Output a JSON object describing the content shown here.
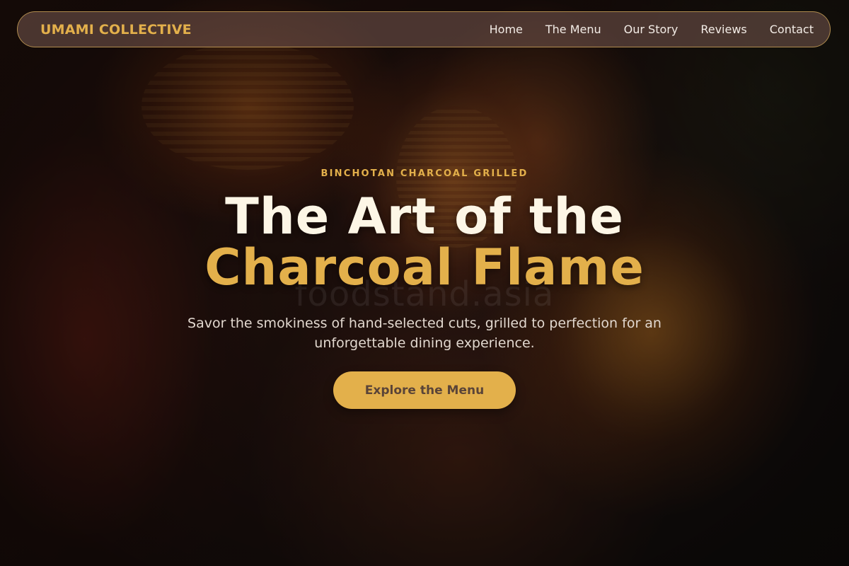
{
  "brand": {
    "name": "UMAMI COLLECTIVE",
    "accent_color": "#e3b04b"
  },
  "nav": {
    "links": [
      {
        "label": "Home"
      },
      {
        "label": "The Menu"
      },
      {
        "label": "Our Story"
      },
      {
        "label": "Reviews"
      },
      {
        "label": "Contact"
      }
    ]
  },
  "hero": {
    "eyebrow": "BINCHOTAN CHARCOAL GRILLED",
    "headline_line1": "The Art of the",
    "headline_line2": "Charcoal Flame",
    "watermark": "foodstand.asia",
    "subtitle": "Savor the smokiness of hand-selected cuts, grilled to perfection for an unforgettable dining experience.",
    "cta_label": "Explore the Menu",
    "background_image": "blurred-red-paper-lanterns"
  }
}
